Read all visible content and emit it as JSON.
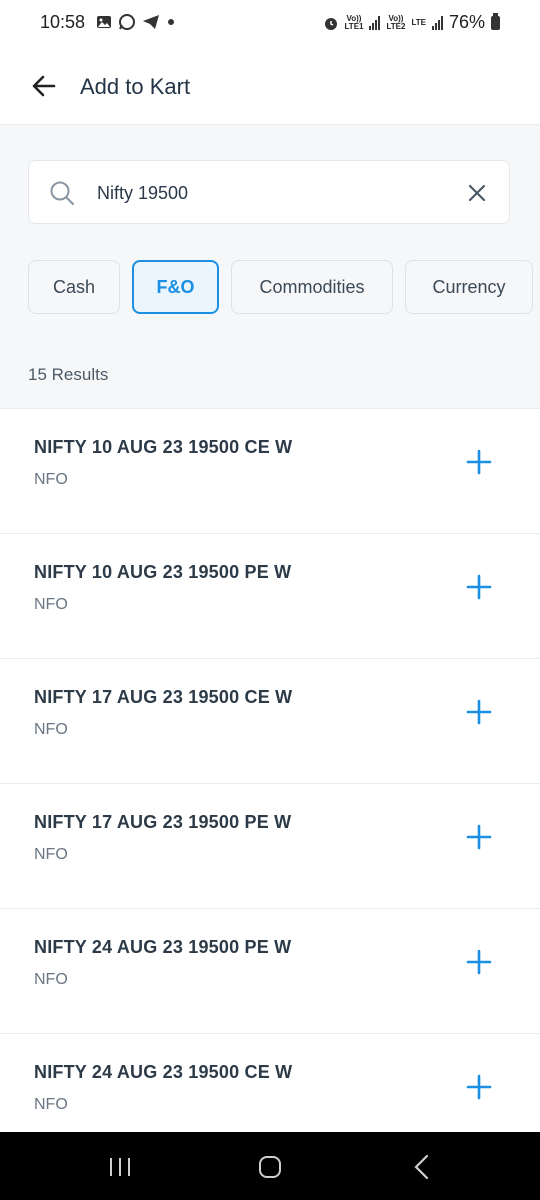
{
  "status_bar": {
    "time": "10:58",
    "battery": "76%",
    "lte1": "LTE1",
    "lte2": "LTE2",
    "volte": "Vo))",
    "lte": "LTE"
  },
  "header": {
    "title": "Add to Kart"
  },
  "search": {
    "value": "Nifty 19500"
  },
  "chips": [
    {
      "label": "Cash"
    },
    {
      "label": "F&O"
    },
    {
      "label": "Commodities"
    },
    {
      "label": "Currency"
    }
  ],
  "active_chip": "F&O",
  "results_label": "15 Results",
  "items": [
    {
      "name": "NIFTY 10 AUG 23 19500 CE W",
      "exchange": "NFO"
    },
    {
      "name": "NIFTY 10 AUG 23 19500 PE W",
      "exchange": "NFO"
    },
    {
      "name": "NIFTY 17 AUG 23 19500 CE W",
      "exchange": "NFO"
    },
    {
      "name": "NIFTY 17 AUG 23 19500 PE W",
      "exchange": "NFO"
    },
    {
      "name": "NIFTY 24 AUG 23 19500 PE W",
      "exchange": "NFO"
    },
    {
      "name": "NIFTY 24 AUG 23 19500 CE W",
      "exchange": "NFO"
    }
  ],
  "colors": {
    "accent": "#1a8fe3",
    "text": "#2d3b49"
  },
  "icons": {
    "back": "arrow-left-icon",
    "search": "search-icon",
    "clear": "close-icon",
    "add": "plus-icon"
  }
}
